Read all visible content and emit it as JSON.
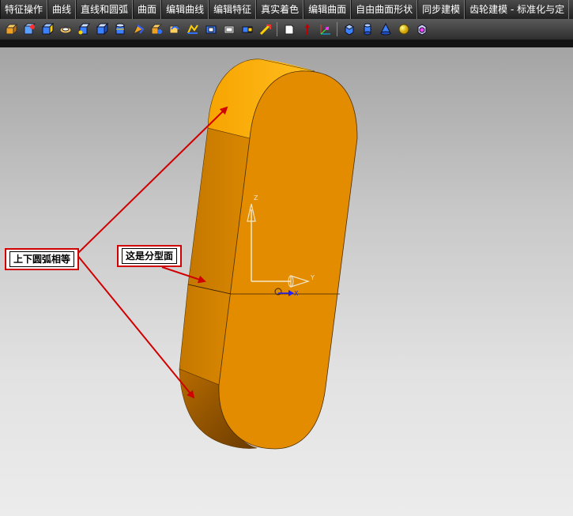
{
  "menu": {
    "tabs": [
      "特征操作",
      "曲线",
      "直线和圆弧",
      "曲面",
      "编辑曲线",
      "编辑特征",
      "真实着色",
      "编辑曲面",
      "自由曲面形状",
      "同步建模",
      "齿轮建模 - 标准化与定"
    ]
  },
  "toolbar": {
    "icons": [
      "extrude-icon",
      "revolve-icon",
      "block-icon",
      "sphere-icon",
      "cone-icon",
      "cylinder-icon",
      "tube-icon",
      "boss-icon",
      "pad-icon",
      "pocket-icon",
      "slot-icon",
      "groove-icon",
      "emboss-icon",
      "pattern-icon",
      "sheet-icon",
      "direction-icon",
      "datum-csys-icon",
      "cube-icon",
      "cylinder-solid-icon",
      "cone-solid-icon",
      "sphere-solid-icon",
      "box-icon"
    ]
  },
  "colors": {
    "part_body": "#e38c00",
    "part_side": "#c97800",
    "annotation": "#d10000"
  },
  "annotations": {
    "arcs_equal": "上下圆弧相等",
    "parting_face": "这是分型面"
  },
  "triad": {
    "z_label": "Z",
    "y_label": "Y",
    "x_label": "X"
  }
}
